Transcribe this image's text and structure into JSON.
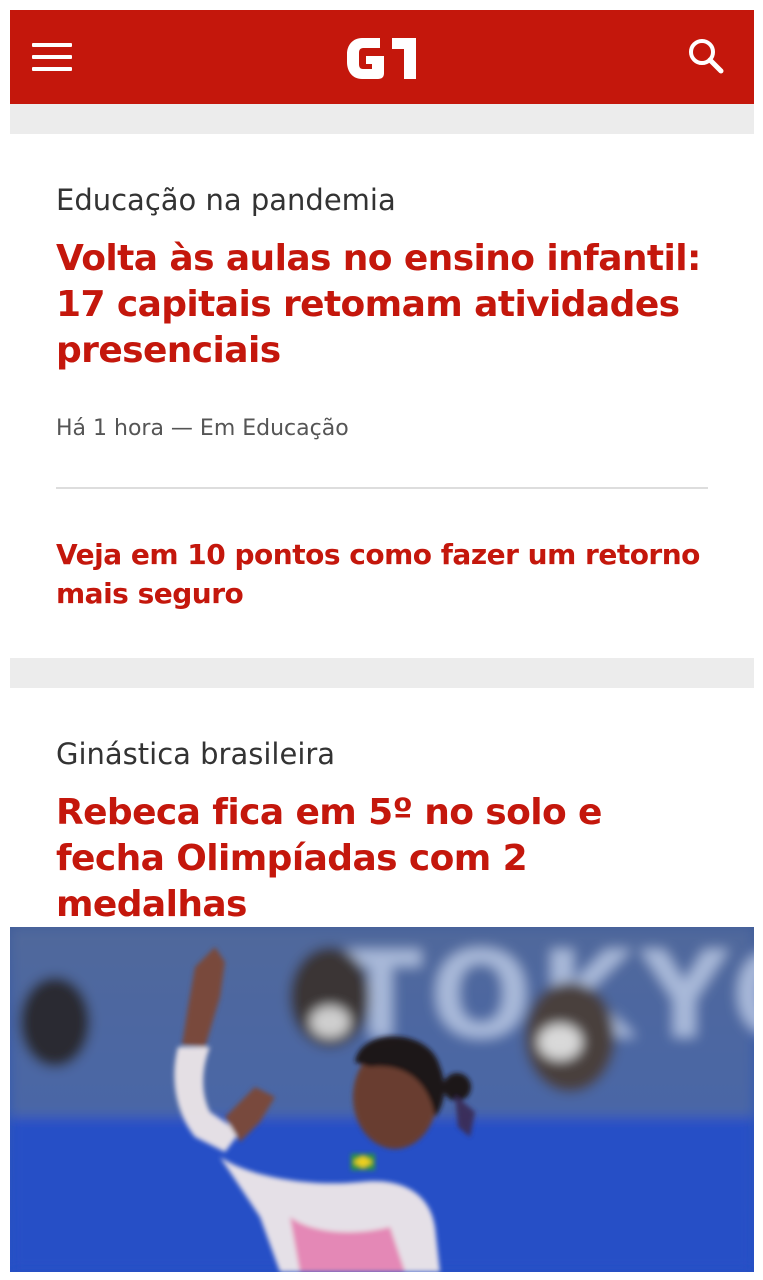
{
  "header": {
    "logo_text": "G1",
    "menu_icon": "hamburger-menu-icon",
    "search_icon": "search-icon",
    "brand_color": "#c4170c"
  },
  "articles": [
    {
      "kicker": "Educação na pandemia",
      "headline": "Volta às aulas no ensino infantil: 17 capitais retomam atividades presenciais",
      "meta": "Há 1 hora — Em Educação",
      "related": "Veja em 10 pontos como fazer um retorno mais seguro"
    },
    {
      "kicker": "Ginástica brasileira",
      "headline": "Rebeca fica em 5º no solo e fecha Olimpíadas com 2 medalhas",
      "image_backdrop_text": "TOKYO"
    }
  ]
}
